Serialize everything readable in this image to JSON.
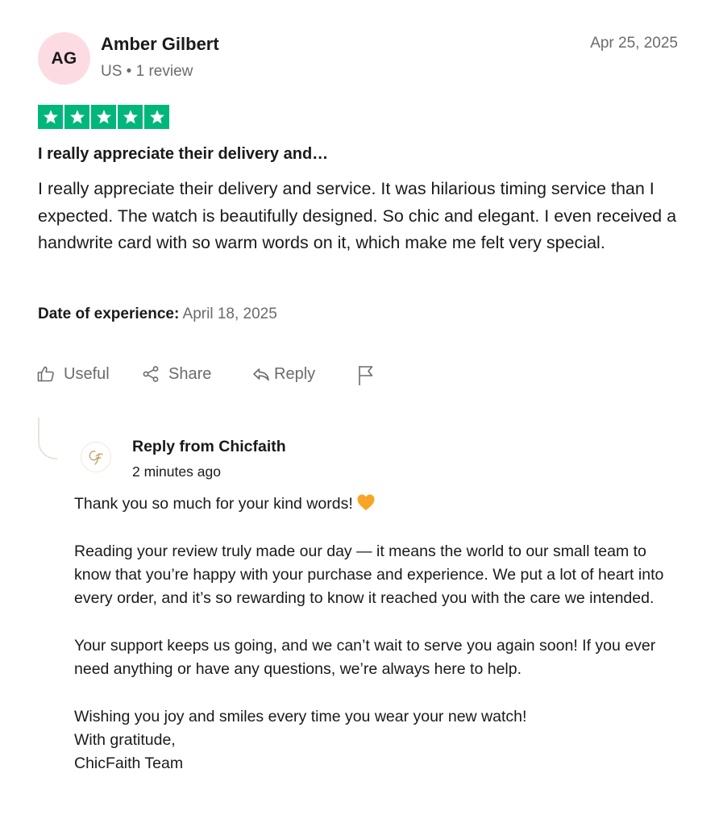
{
  "reviewer": {
    "initials": "AG",
    "name": "Amber Gilbert",
    "meta": "US • 1 review",
    "avatar_color": "#fddbe3"
  },
  "review": {
    "date": "Apr 25, 2025",
    "rating": 5,
    "rating_color": "#00b67a",
    "title": "I really appreciate their delivery and…",
    "body": "I really appreciate their delivery and service. It was hilarious timing service than I expected. The watch is beautifully designed. So chic and elegant. I even received a handwrite card with so warm words on it, which make me felt very special.",
    "experience_label": "Date of experience:",
    "experience_date": "April 18, 2025"
  },
  "actions": {
    "useful": "Useful",
    "share": "Share",
    "reply": "Reply",
    "report_icon": "flag-icon"
  },
  "company_reply": {
    "from": "Reply from Chicfaith",
    "time": "2 minutes ago",
    "line1": "Thank you so much for your kind words!",
    "line1_emoji": "orange-heart-icon",
    "para2": "Reading your review truly made our day — it means the world to our small team to know that you’re happy with your purchase and experience. We put a lot of heart into every order, and it’s so rewarding to know it reached you with the care we intended.",
    "para3": "Your support keeps us going, and we can’t wait to serve you again soon! If you ever need anything or have any questions, we’re always here to help.",
    "closing1": "Wishing you joy and smiles every time you wear your new watch!",
    "closing2": "With gratitude,",
    "closing3": "ChicFaith Team"
  }
}
